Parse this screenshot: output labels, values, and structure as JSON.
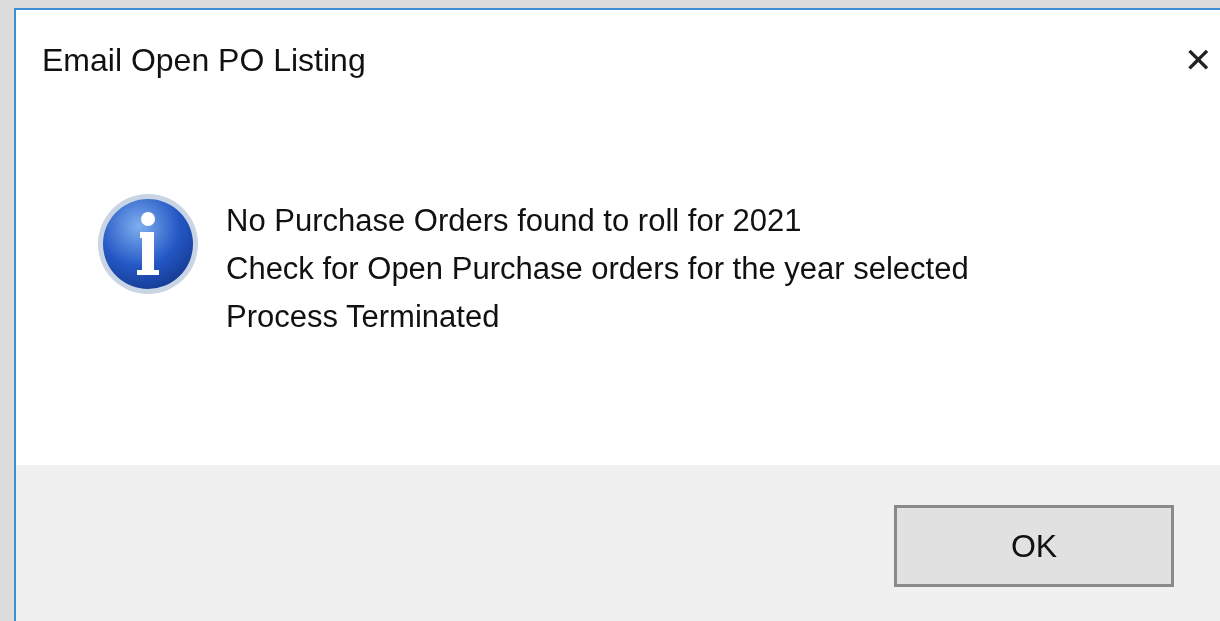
{
  "window": {
    "title": "Email Open PO Listing",
    "close": "✕"
  },
  "message": {
    "lines": [
      "No Purchase Orders found to roll for 2021",
      "Check for Open Purchase orders for the year selected",
      "Process Terminated"
    ]
  },
  "buttons": [
    {
      "label": "OK"
    }
  ]
}
